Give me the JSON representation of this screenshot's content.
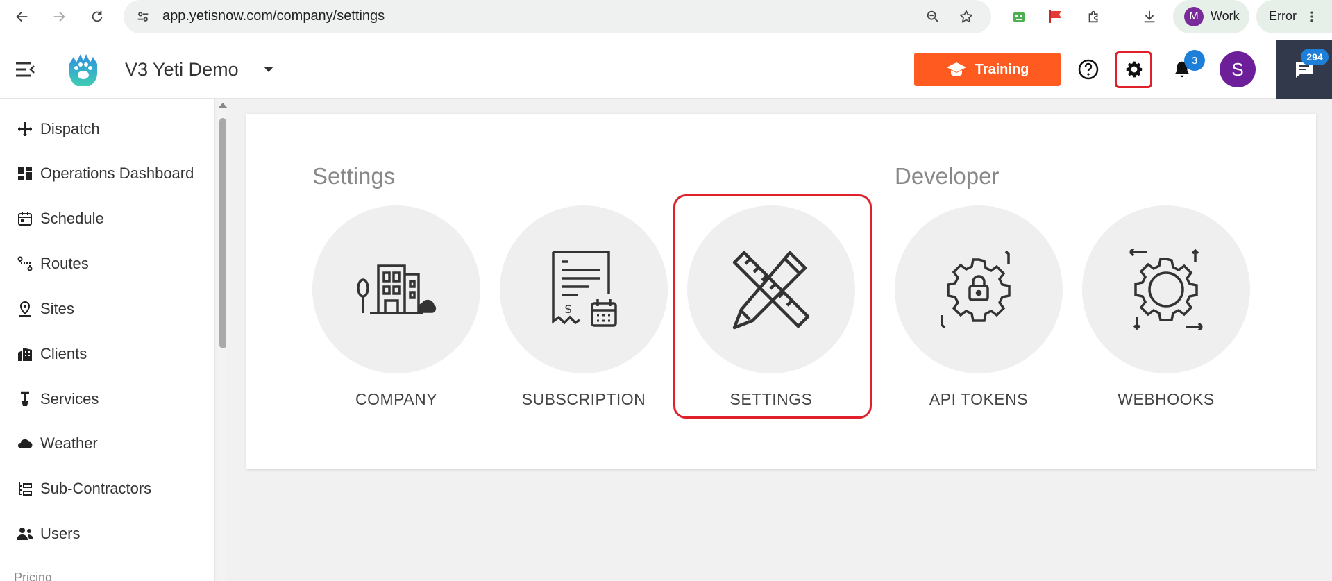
{
  "browser": {
    "url": "app.yetisnow.com/company/settings",
    "profile_initial": "M",
    "profile_name": "Work",
    "error_label": "Error"
  },
  "header": {
    "company_name": "V3 Yeti Demo",
    "training_label": "Training",
    "notifications_count": "3",
    "user_initial": "S",
    "chat_count": "294"
  },
  "sidebar": {
    "items": [
      {
        "label": "Dispatch"
      },
      {
        "label": "Operations Dashboard"
      },
      {
        "label": "Schedule"
      },
      {
        "label": "Routes"
      },
      {
        "label": "Sites"
      },
      {
        "label": "Clients"
      },
      {
        "label": "Services"
      },
      {
        "label": "Weather"
      },
      {
        "label": "Sub-Contractors"
      },
      {
        "label": "Users"
      }
    ],
    "next_section": "Pricing"
  },
  "main": {
    "settings_title": "Settings",
    "developer_title": "Developer",
    "tiles": [
      {
        "label": "COMPANY"
      },
      {
        "label": "SUBSCRIPTION"
      },
      {
        "label": "SETTINGS"
      },
      {
        "label": "API TOKENS"
      },
      {
        "label": "WEBHOOKS"
      }
    ]
  },
  "colors": {
    "accent_orange": "#ff5a1f",
    "highlight_red": "#e0202a",
    "badge_blue": "#1e7fd8",
    "avatar_purple": "#6d1f9a"
  }
}
